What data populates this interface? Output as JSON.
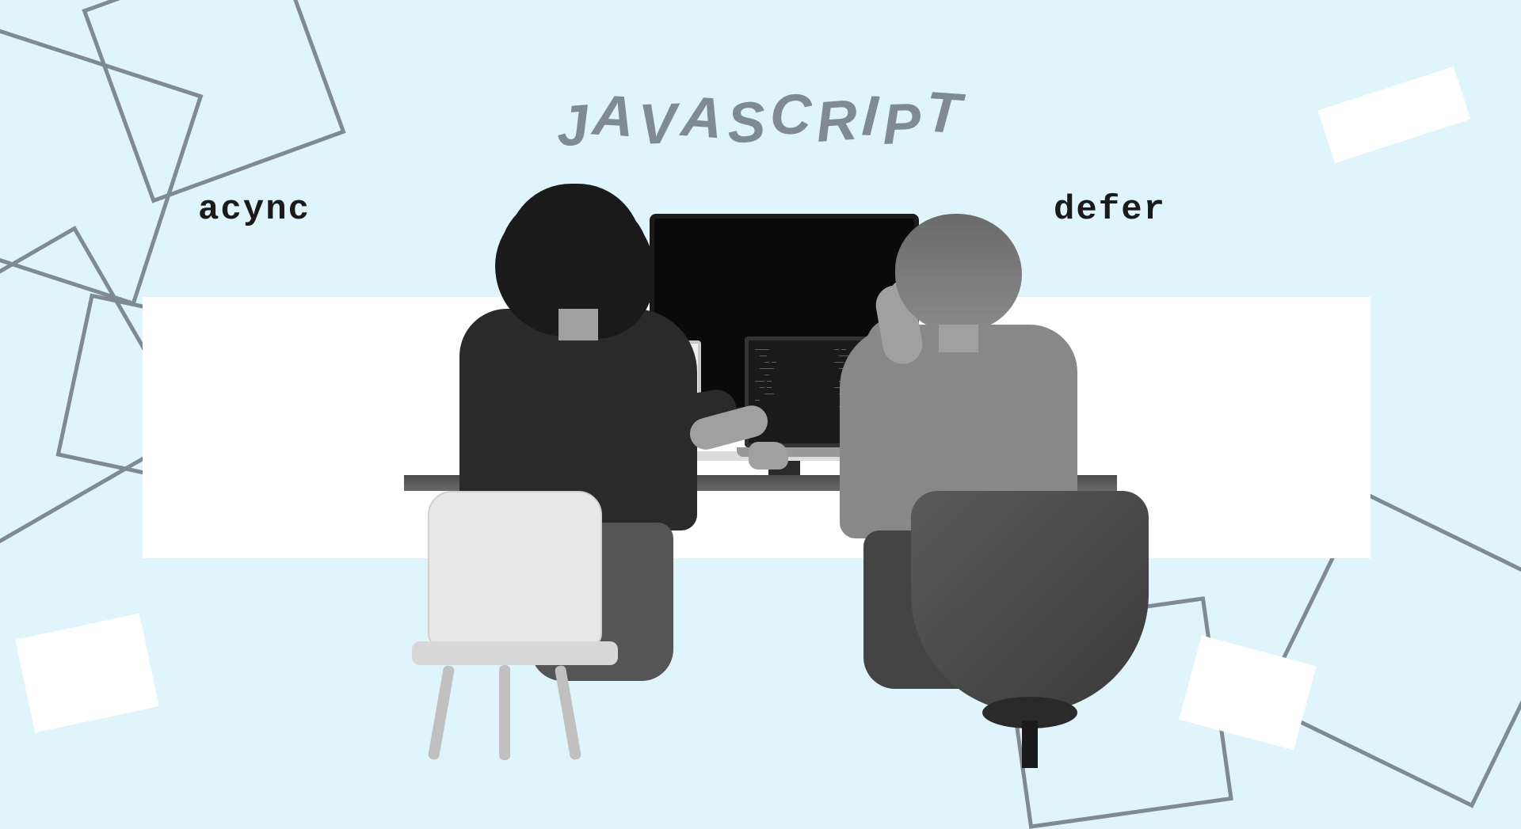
{
  "title": "JAVASCRIPT",
  "labels": {
    "left": "acync",
    "right": "defer"
  },
  "colors": {
    "background": "#dff4fb",
    "accent_gray": "#7f8a94",
    "text_dark": "#1a1a1a",
    "white": "#ffffff"
  }
}
